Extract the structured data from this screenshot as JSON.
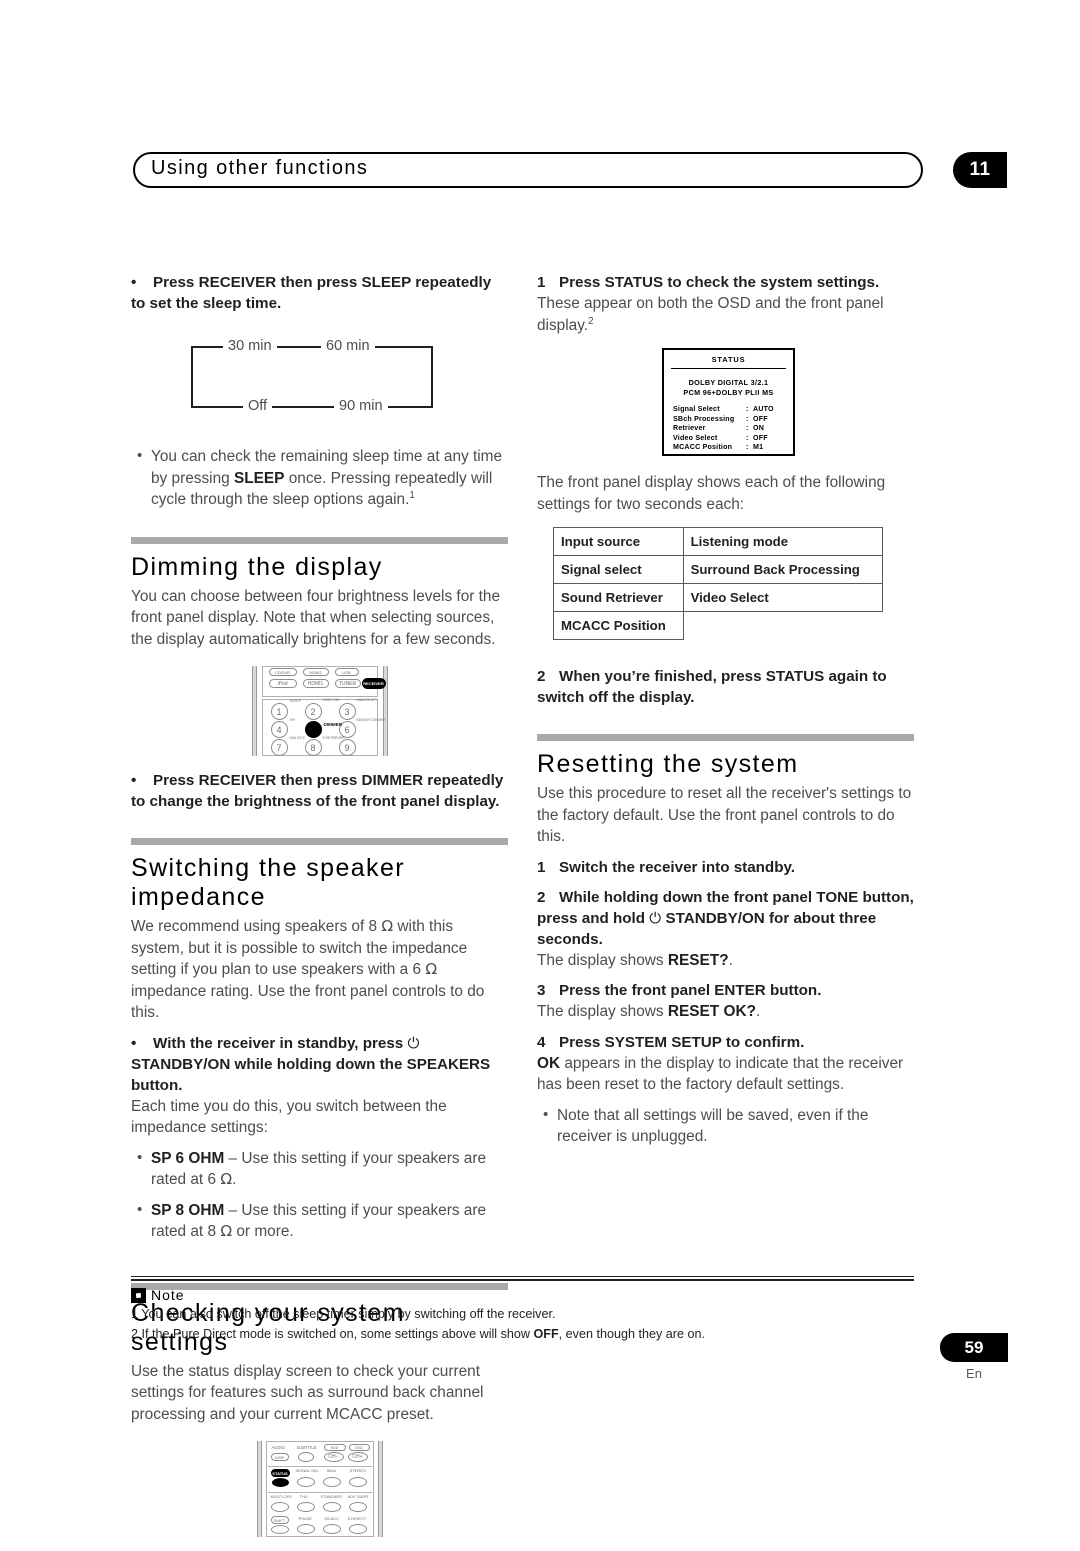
{
  "header": {
    "title": "Using other functions",
    "chapter": "11"
  },
  "left_column": {
    "sleep_instruction": "Press RECEIVER then press SLEEP repeatedly to set the sleep time.",
    "sleep_diagram": {
      "labels": [
        "30 min",
        "60 min",
        "90 min",
        "Off"
      ]
    },
    "sleep_note_pre": "You can check the remaining sleep time at any time by pressing ",
    "sleep_note_bold": "SLEEP",
    "sleep_note_post": " once. Pressing repeatedly will cycle through the sleep options again.",
    "sleep_note_fn": "1",
    "dimming": {
      "title": "Dimming the display",
      "body": "You can choose between four brightness levels for the front panel display. Note that when selecting sources, the display automatically brightens for a few seconds.",
      "instruction": "Press RECEIVER then press DIMMER repeatedly to change the brightness of the front panel display."
    },
    "impedance": {
      "title": "Switching the speaker impedance",
      "body_1": "We recommend using speakers of 8 ",
      "body_ohm_1": "Ω",
      "body_2": " with this system, but it is possible to switch the impedance setting if you plan to use speakers with a 6 ",
      "body_ohm_2": "Ω",
      "body_3": " impedance rating. Use the front panel controls to do this.",
      "instruction_pre": "With the receiver in standby, press ",
      "instruction_power": "⏻",
      "instruction_post": " STANDBY/ON while holding down the SPEAKERS button.",
      "each_time": "Each time you do this, you switch between the impedance settings:",
      "options": [
        {
          "label": "SP 6 OHM",
          "text_pre": " – Use this setting if your speakers are rated at 6 ",
          "ohm": "Ω",
          "text_post": "."
        },
        {
          "label": "SP 8 OHM",
          "text_pre": " – Use this setting if your speakers are rated at 8 ",
          "ohm": "Ω",
          "text_post": " or more."
        }
      ]
    },
    "checking": {
      "title": "Checking your system settings",
      "body": "Use the status display screen to check your current settings for features such as surround back channel processing and your current MCACC preset."
    },
    "remote_top": {
      "source_row1": [
        "CD/DVR",
        "HDMI2",
        "USB"
      ],
      "source_row2": [
        "iPod",
        "HDMI1",
        "TUNER"
      ],
      "receiver_button": "RECEIVER",
      "keys": [
        "1",
        "2",
        "3",
        "4",
        "5",
        "6",
        "7",
        "8",
        "9"
      ],
      "key_labels": [
        "SLEEP",
        "VIDEO SEL",
        "ANALOG ATT",
        "SPr",
        "DIMMER",
        "BDNIGHT DIMMER",
        "DIALOG E",
        "S.RETRIEVER",
        ""
      ],
      "dimmer_label": "DIMMER"
    },
    "remote_bottom": {
      "row_labels_1": [
        "AUDIO",
        "SUBTITLE",
        "HDD",
        "DVD"
      ],
      "btn_disp": "DISP",
      "row_labels_2": [
        "STATUS",
        "SIGNAL SEL",
        "SBch",
        "STEREO"
      ],
      "row_labels_3": [
        "MULTI-OPE",
        "THX",
        "STANDARD",
        "ADV SURR"
      ],
      "row_labels_4": [
        "SHIFT",
        "PHASE",
        "MCACC",
        "S.DIRECT"
      ],
      "status_button": "STATUS"
    }
  },
  "right_column": {
    "step1": "Press STATUS to check the system settings.",
    "step1_body": "These appear on both the OSD and the front panel display.",
    "step1_fn": "2",
    "osd": {
      "title": "STATUS",
      "format_lines": [
        "DOLBY DIGITAL 3/2.1",
        "PCM 96+DOLBY PLII MS"
      ],
      "rows": [
        {
          "key": "Signal  Select",
          "value": "AUTO"
        },
        {
          "key": "SBch  Processing",
          "value": "OFF"
        },
        {
          "key": "Retriever",
          "value": "ON"
        },
        {
          "key": "Video  Select",
          "value": "OFF"
        },
        {
          "key": "MCACC  Position",
          "value": "M1"
        }
      ]
    },
    "front_panel_intro": "The front panel display shows each of the following settings for two seconds each:",
    "settings_table": [
      [
        "Input source",
        "Listening mode"
      ],
      [
        "Signal select",
        "Surround Back Processing"
      ],
      [
        "Sound Retriever",
        "Video Select"
      ],
      [
        "MCACC Position",
        ""
      ]
    ],
    "step2": "When you’re finished, press STATUS again to switch off the display.",
    "resetting": {
      "title": "Resetting the system",
      "body": "Use this procedure to reset all the receiver's settings to the factory default. Use the front panel controls to do this.",
      "step1": "Switch the receiver into standby.",
      "step2_pre": "While holding down the front panel TONE button, press and hold ",
      "step2_power": "⏻",
      "step2_post": " STANDBY/ON for about three seconds.",
      "step2_result_pre": "The display shows ",
      "step2_result_bold": "RESET?",
      "step2_result_post": ".",
      "step3": "Press the front panel ENTER button.",
      "step3_result_pre": "The display shows ",
      "step3_result_bold": "RESET OK?",
      "step3_result_post": ".",
      "step4": "Press SYSTEM SETUP to confirm.",
      "step4_result_bold": "OK",
      "step4_result_post": " appears in the display to indicate that the receiver has been reset to the factory default settings.",
      "final_note": "Note that all settings will be saved, even if the receiver is unplugged."
    }
  },
  "notes": {
    "heading": "Note",
    "note1": "1 You can also switch off the sleep timer simply by switching off the receiver.",
    "note2_pre": "2 If the Pure Direct mode is switched on, some settings above will show ",
    "note2_bold": "OFF",
    "note2_post": ", even though they are on."
  },
  "footer": {
    "page_number": "59",
    "language": "En"
  }
}
